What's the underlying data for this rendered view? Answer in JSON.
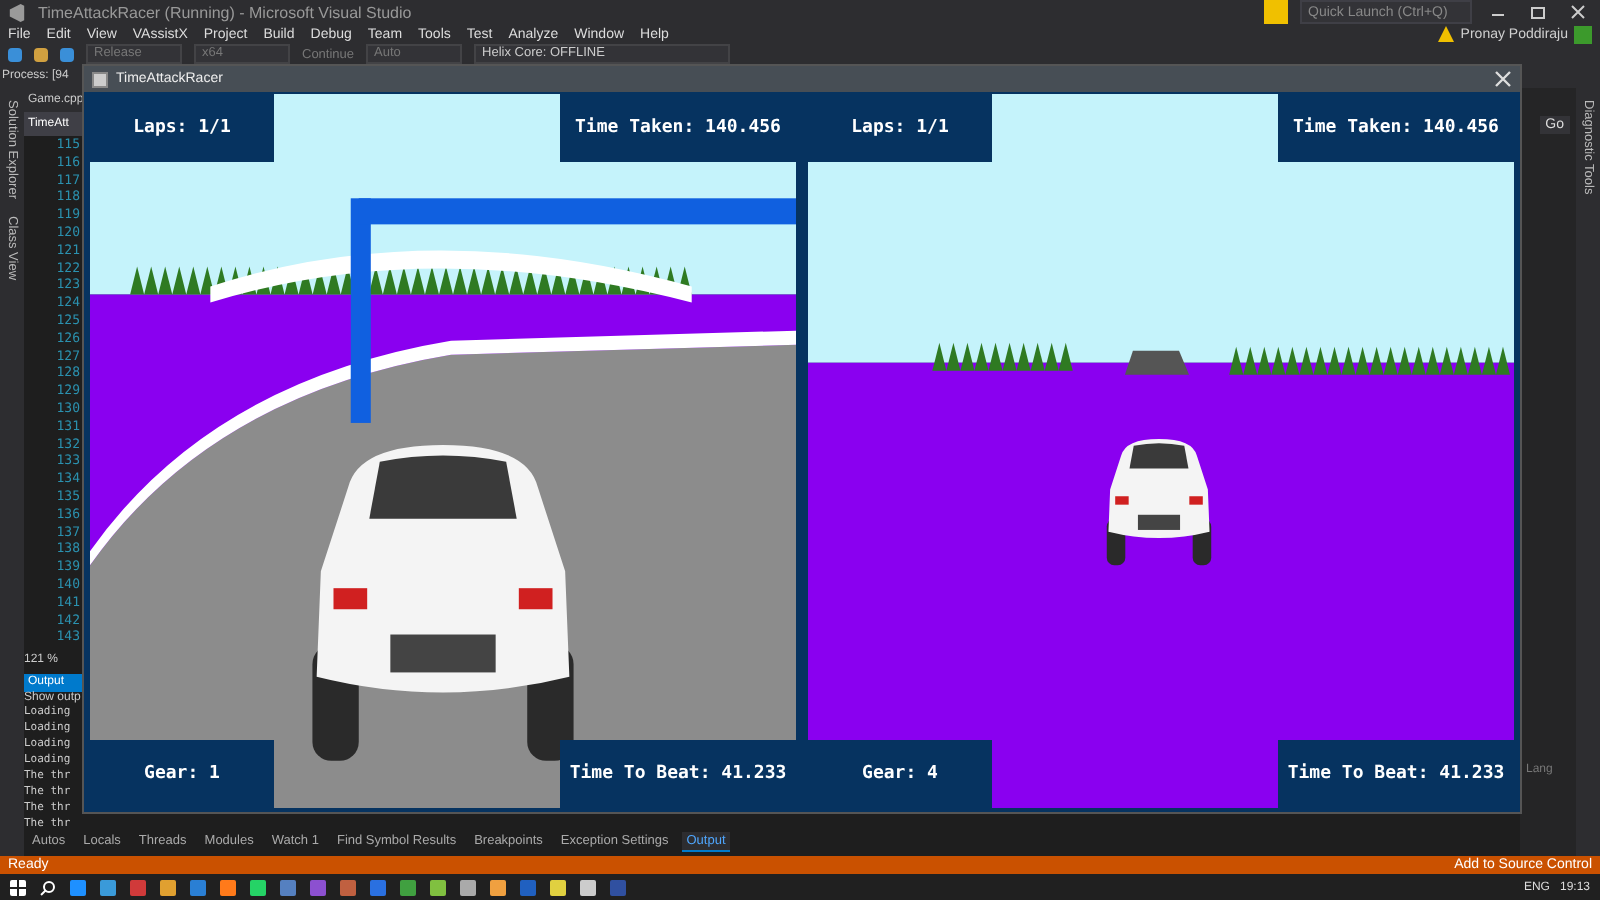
{
  "window": {
    "title": "TimeAttackRacer (Running) - Microsoft Visual Studio"
  },
  "quick_launch": {
    "placeholder": "Quick Launch (Ctrl+Q)"
  },
  "menu": [
    "File",
    "Edit",
    "View",
    "VAssistX",
    "Project",
    "Build",
    "Debug",
    "Team",
    "Tools",
    "Test",
    "Analyze",
    "Window",
    "Help"
  ],
  "user": {
    "name": "Pronay Poddiraju"
  },
  "toolbar": {
    "configuration": "Release",
    "platform": "x64",
    "continue": "Continue",
    "auto": "Auto",
    "helix": "Helix Core: OFFLINE"
  },
  "process": {
    "label": "Process:",
    "value": "[94"
  },
  "side_tabs": [
    "Solution Explorer",
    "Class View"
  ],
  "editor_tabs": [
    {
      "label": "Game.cpp",
      "selected": false
    },
    {
      "label": "TimeAtt",
      "selected": true
    }
  ],
  "line_numbers": [
    "115",
    "116",
    "117",
    "118",
    "119",
    "120",
    "121",
    "122",
    "123",
    "124",
    "125",
    "126",
    "127",
    "128",
    "129",
    "130",
    "131",
    "132",
    "133",
    "134",
    "135",
    "136",
    "137",
    "138",
    "139",
    "140",
    "141",
    "142",
    "143"
  ],
  "zoom": "121 %",
  "output": {
    "title": "Output",
    "show_output": "Show outp",
    "lines": [
      "Loading",
      "Loading",
      "Loading",
      "Loading",
      "The thr",
      "The thr",
      "The thr",
      "The thr"
    ]
  },
  "bottom_tabs": [
    {
      "label": "Autos",
      "selected": false
    },
    {
      "label": "Locals",
      "selected": false
    },
    {
      "label": "Threads",
      "selected": false
    },
    {
      "label": "Modules",
      "selected": false
    },
    {
      "label": "Watch 1",
      "selected": false
    },
    {
      "label": "Find Symbol Results",
      "selected": false
    },
    {
      "label": "Breakpoints",
      "selected": false
    },
    {
      "label": "Exception Settings",
      "selected": false
    },
    {
      "label": "Output",
      "selected": true
    }
  ],
  "right_panel": {
    "tab": "Diagnostic Tools",
    "go": "Go",
    "lang": "Lang"
  },
  "status": {
    "text": "Ready",
    "source_control": "Add to Source Control"
  },
  "tray": {
    "language": "ENG",
    "time": "19:13"
  },
  "game": {
    "title": "TimeAttackRacer",
    "viewports": [
      {
        "kind": "track",
        "laps": "Laps: 1/1",
        "time_taken": "Time Taken: 140.456",
        "gear": "Gear: 1",
        "time_to_beat": "Time To Beat: 41.233"
      },
      {
        "kind": "open",
        "laps": "Laps: 1/1",
        "time_taken": "Time Taken: 140.456",
        "gear": "Gear: 4",
        "time_to_beat": "Time To Beat: 41.233"
      }
    ]
  }
}
